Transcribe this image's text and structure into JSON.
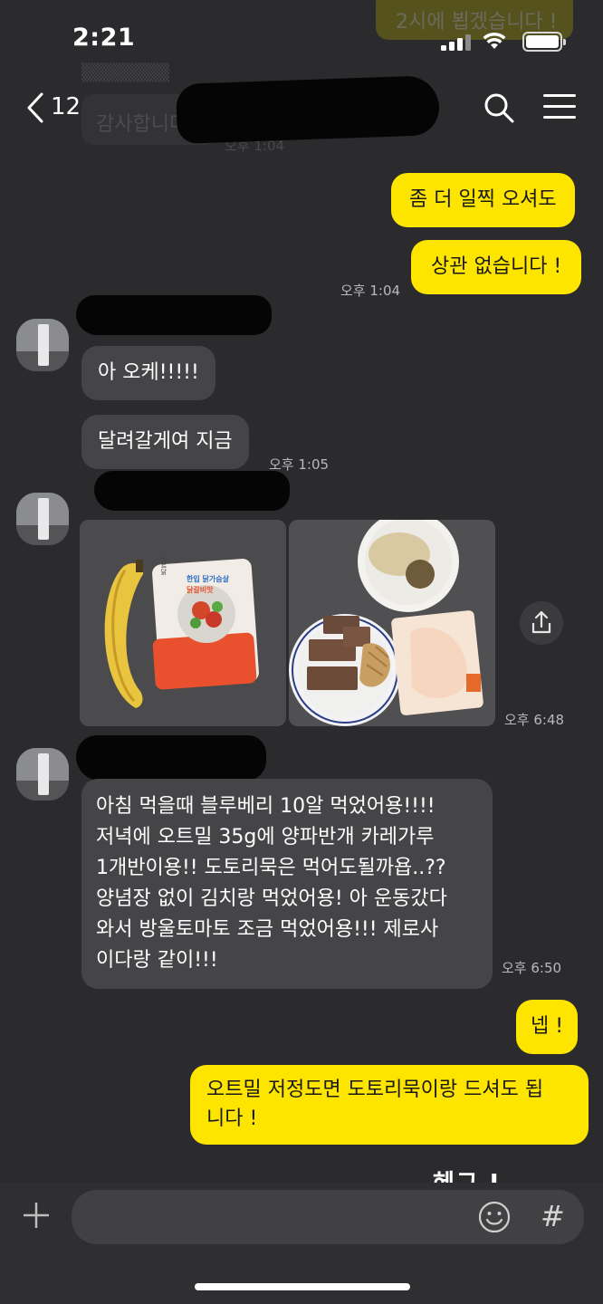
{
  "status_bar": {
    "time": "2:21"
  },
  "ghost": {
    "bubble_text": "2시에 뵙겠습니다 !",
    "text": "감사합니다",
    "time": "오후 1:04"
  },
  "header": {
    "unread_count": "12"
  },
  "messages": [
    {
      "id": "m1",
      "sender": "me",
      "text": "좀 더 일찍 오셔도"
    },
    {
      "id": "m2",
      "sender": "me",
      "text": "상관 없습니다 !",
      "time": "오후 1:04"
    },
    {
      "id": "m3",
      "sender": "them",
      "text": "아 오케!!!!!"
    },
    {
      "id": "m4",
      "sender": "them",
      "text": "달려갈게여 지금",
      "time": "오후 1:05"
    },
    {
      "id": "m5",
      "sender": "them",
      "type": "photos",
      "time": "오후 6:48"
    },
    {
      "id": "m6",
      "sender": "them",
      "lines": [
        "아침 먹을때 블루베리 10알 먹었어용!!!!",
        "저녁에 오트밀 35g에 양파반개 카레가루",
        "1개반이용!! 도토리묵은 먹어도될까욥..??",
        "양념장 없이 김치랑 먹었어용! 아 운동갔다",
        "와서 방울토마토 조금 먹었어용!!! 제로사",
        "이다랑 같이!!!"
      ],
      "time": "오후 6:50"
    },
    {
      "id": "m7",
      "sender": "me",
      "text": "넵 !"
    },
    {
      "id": "m8",
      "sender": "me",
      "lines": [
        "오트밀 저정도면 도토리묵이랑 드셔도 됩",
        "니다 !"
      ]
    }
  ],
  "photo_labels": {
    "chicken_pack": "한입 닭가슴살",
    "chicken_flavor": "닭갈비맛",
    "brand": "바르닭"
  },
  "partial_text": "헤그 I",
  "colors": {
    "my_bubble": "#fee500",
    "their_bubble": "#454548",
    "background": "#2b2b2e"
  },
  "icons": [
    "back-arrow-icon",
    "search-icon",
    "menu-icon",
    "share-icon",
    "plus-icon",
    "emoji-icon",
    "hash-icon"
  ],
  "input": {
    "hash_label": "#"
  }
}
